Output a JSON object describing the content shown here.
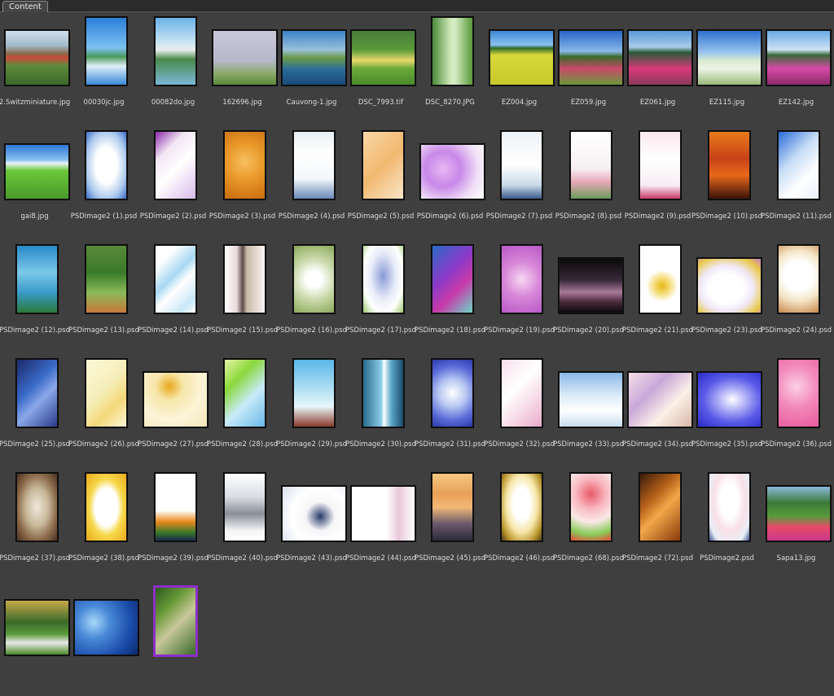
{
  "panel": {
    "tab_label": "Content"
  },
  "items": [
    {
      "name": "2.Switzminiature.jpg",
      "shape": "land",
      "bg": "linear-gradient(#cfe0ef 0%,#9fb8c8 28%,#8a6a4a 42%,#c94a3a 50%,#5f8a3c 64%,#3a6a2a 100%)"
    },
    {
      "name": "00030jc.jpg",
      "shape": "port",
      "bg": "linear-gradient(#2a7fd8 0%,#7ec2f2 45%,#4a9a5a 58%,#dfeef8 72%,#3a8ad8 100%)"
    },
    {
      "name": "00082do.jpg",
      "shape": "port",
      "bg": "linear-gradient(#6ab2e8 0%,#cfe6f2 38%,#e8eef0 48%,#4a8a4a 62%,#7ab8d8 100%)"
    },
    {
      "name": "162696.jpg",
      "shape": "land",
      "bg": "linear-gradient(#c8c8d8 0%,#b8b8cc 55%,#8aa868 80%,#5a8a3a 100%)"
    },
    {
      "name": "Cauvong-1.jpg",
      "shape": "land",
      "bg": "linear-gradient(#3a82c8 0%,#9ac0d8 35%,#6a9a4a 50%,#2a6a9a 72%,#1a4a7a 100%)"
    },
    {
      "name": "DSC_7993.tif",
      "shape": "land",
      "bg": "linear-gradient(#4a7a3a 0%,#5a9a3a 35%,#e8d86a 55%,#6aaa3a 70%,#4a8a2a 100%)"
    },
    {
      "name": "DSC_8270.JPG",
      "shape": "port",
      "bg": "linear-gradient(90deg,#4a8a3a 0%,#cfe8b8 45%,#d8eec8 55%,#5a9a3a 100%)"
    },
    {
      "name": "EZ004.jpg",
      "shape": "land",
      "bg": "linear-gradient(#3f86d8 0%,#8ac2ee 26%,#2f6a2a 32%,#d8d83a 45%,#c8c82a 100%)"
    },
    {
      "name": "EZ059.jpg",
      "shape": "land",
      "bg": "linear-gradient(#2a66c8 0%,#8ab8e8 38%,#3a6a2a 48%,#c84a6a 70%,#6a9a3a 100%)"
    },
    {
      "name": "EZ061.jpg",
      "shape": "land",
      "bg": "linear-gradient(#5a9ad8 0%,#a8cce8 30%,#2a5a3a 40%,#d83a7a 70%,#8a3a5a 100%)"
    },
    {
      "name": "EZ115.jpg",
      "shape": "land",
      "bg": "linear-gradient(#2f6fcf 0%,#9ac6ee 40%,#d8e8d0 55%,#eef4e8 70%,#9aba7a 100%)"
    },
    {
      "name": "EZ142.jpg",
      "shape": "land",
      "bg": "linear-gradient(#6aaae8 0%,#cfe2f2 35%,#3a6a3a 45%,#d84aa8 70%,#8a2a6a 100%)"
    },
    {
      "name": "gai8.jpg",
      "shape": "land",
      "bg": "linear-gradient(#2f78d8 0%,#8ac0ee 28%,#e8f2f8 34%,#6ac83a 48%,#4a9a2a 100%)"
    },
    {
      "name": "PSDimage2 (1).psd",
      "shape": "port",
      "bg": "radial-gradient(ellipse at 50% 50%,#ffffff 38%,#aac8ec 72%,#3a6ac8 100%)"
    },
    {
      "name": "PSDimage2 (2).psd",
      "shape": "port",
      "bg": "linear-gradient(135deg,#8a2aa8 0%,#f2e6f4 28%,#ffffff 55%,#d8b8e8 100%)"
    },
    {
      "name": "PSDimage2 (3).psd",
      "shape": "port",
      "bg": "radial-gradient(circle at 50% 45%,#f8c060 0%,#e89828 45%,#c86a10 100%)"
    },
    {
      "name": "PSDimage2 (4).psd",
      "shape": "port",
      "bg": "linear-gradient(#e8eef4 0%,#ffffff 30%,#f4f8fa 70%,#6a8ab8 100%)"
    },
    {
      "name": "PSDimage2 (5).psd",
      "shape": "port",
      "bg": "linear-gradient(135deg,#f8d8a8 0%,#f2b870 50%,#fae6c8 100%)"
    },
    {
      "name": "PSDimage2 (6).psd",
      "shape": "land",
      "bg": "radial-gradient(circle at 35% 45%,#e8b8f4 0%,#c888e8 35%,#f0e0f6 70%,#ffffff 100%)"
    },
    {
      "name": "PSDimage2 (7).psd",
      "shape": "port",
      "bg": "linear-gradient(#eef2f6 0%,#ffffff 50%,#c8d8e8 80%,#3a5a8a 100%)"
    },
    {
      "name": "PSDimage2 (8).psd",
      "shape": "port",
      "bg": "linear-gradient(#ffffff 0%,#f6f0f2 55%,#e8a8b8 75%,#6a9a5a 100%)"
    },
    {
      "name": "PSDimage2 (9).psd",
      "shape": "port",
      "bg": "linear-gradient(#fbe8f0 0%,#ffffff 40%,#f8eef4 80%,#c83a6a 100%)"
    },
    {
      "name": "PSDimage2 (10).psd",
      "shape": "port",
      "bg": "linear-gradient(#e87a1a 0%,#c8421a 40%,#e8681a 65%,#3a120a 100%)"
    },
    {
      "name": "PSDimage2 (11).psd",
      "shape": "port",
      "bg": "linear-gradient(135deg,#2a6ad8 0%,#c8def6 40%,#ffffff 70%,#e8f0fa 100%)"
    },
    {
      "name": "PSDimage2 (12).psd",
      "shape": "port",
      "bg": "linear-gradient(#2a8ac8 0%,#7ac8e8 40%,#3a9ac8 70%,#2a7a3a 100%)"
    },
    {
      "name": "PSDimage2 (13).psd",
      "shape": "port",
      "bg": "linear-gradient(#5a8a3a 0%,#3a7a2a 40%,#8aba5a 70%,#c8783a 100%)"
    },
    {
      "name": "PSDimage2 (14).psd",
      "shape": "port",
      "bg": "linear-gradient(135deg,#ffffff 20%,#a8d8f2 45%,#ffffff 60%,#c8e8f8 85%,#ffffff 100%)"
    },
    {
      "name": "PSDimage2 (15).psd",
      "shape": "port",
      "bg": "linear-gradient(90deg,#ffffff 0%,#e8d8d8 30%,#5a4a4a 45%,#c8b8a8 55%,#fbf4f2 100%)"
    },
    {
      "name": "PSDimage2 (16).psd",
      "shape": "port",
      "bg": "radial-gradient(circle at 50% 50%,#ffffff 20%,#c8d8a8 55%,#8aa85a 100%)"
    },
    {
      "name": "PSDimage2 (17).psd",
      "shape": "port",
      "bg": "radial-gradient(ellipse at 50% 45%,#8a9ad8 0%,#e8ecf8 45%,#ffffff 70%,#9ac86a 100%)"
    },
    {
      "name": "PSDimage2 (18).psd",
      "shape": "port",
      "bg": "linear-gradient(135deg,#2a6ac8 0%,#8a3ac8 40%,#c83aa8 65%,#6ad8c8 100%)"
    },
    {
      "name": "PSDimage2 (19).psd",
      "shape": "port",
      "bg": "radial-gradient(circle at 50% 50%,#f8d8f4 0%,#d888d8 45%,#b858c8 100%)"
    },
    {
      "name": "PSDimage2 (20).psd",
      "shape": "land",
      "bg": "linear-gradient(#0a0a0a 0%,#3a2a3a 40%,#a87a9a 62%,#4a2a3a 80%,#0a0a0a 100%)"
    },
    {
      "name": "PSDimage2 (21).psd",
      "shape": "port",
      "bg": "radial-gradient(circle at 55% 60%,#e8b81a 0%,#f2d86a 15%,#ffffff 35%,#ffffff 100%)"
    },
    {
      "name": "PSDimage2 (23).psd",
      "shape": "land",
      "bg": "radial-gradient(ellipse at 45% 55%,#ffffff 35%,#f0e8f6 55%,#e8c84a 80%,#c87ac8 100%)"
    },
    {
      "name": "PSDimage2 (24).psd",
      "shape": "port",
      "bg": "radial-gradient(circle at 50% 45%,#ffffff 35%,#f4e6c8 60%,#c8884a 100%)"
    },
    {
      "name": "PSDimage2 (25).psd",
      "shape": "port",
      "bg": "linear-gradient(135deg,#1a2a6a 0%,#3a6ac8 40%,#8aa8e8 60%,#2a3a8a 100%)"
    },
    {
      "name": "PSDimage2 (26).psd",
      "shape": "port",
      "bg": "linear-gradient(135deg,#fbf8d8 0%,#f6eeb8 45%,#f2d87a 70%,#fbf6d8 100%)"
    },
    {
      "name": "PSDimage2 (27).psd",
      "shape": "land",
      "bg": "radial-gradient(circle at 40% 25%,#e8a81a 0%,#f6e6a8 25%,#fbf4d8 60%,#f2e6b8 100%)"
    },
    {
      "name": "PSDimage2 (28).psd",
      "shape": "port",
      "bg": "linear-gradient(135deg,#e8f6a8 0%,#8ad83a 30%,#c8eaf8 60%,#6ab8e8 100%)"
    },
    {
      "name": "PSDimage2 (29).psd",
      "shape": "port",
      "bg": "linear-gradient(#5ab8e8 0%,#a8dcf2 40%,#e8f6fa 70%,#8a3a2a 100%)"
    },
    {
      "name": "PSDimage2 (30).psd",
      "shape": "port",
      "bg": "linear-gradient(90deg,#2a6a8a 0%,#8acce8 45%,#ffffff 52%,#5aa8c8 70%,#1a4a6a 100%)"
    },
    {
      "name": "PSDimage2 (31).psd",
      "shape": "port",
      "bg": "radial-gradient(circle at 50% 50%,#ffffff 0%,#b8c8f2 35%,#5a6ad8 70%,#2a3aa8 100%)"
    },
    {
      "name": "PSDimage2 (32).psd",
      "shape": "port",
      "bg": "linear-gradient(135deg,#f8e0ec 0%,#ffffff 40%,#f4d0e0 75%,#e8a8c8 100%)"
    },
    {
      "name": "PSDimage2 (33).psd",
      "shape": "land",
      "bg": "linear-gradient(#8ab8e8 0%,#d8e8f6 40%,#ffffff 70%,#c8dcee 100%)"
    },
    {
      "name": "PSDimage2 (34).psd",
      "shape": "land",
      "bg": "linear-gradient(135deg,#f6e0e8 0%,#c8a8d8 35%,#fbf0e8 65%,#d8b8a8 100%)"
    },
    {
      "name": "PSDimage2 (35).psd",
      "shape": "land",
      "bg": "radial-gradient(ellipse at 55% 50%,#ffffff 0%,#b8b8f8 25%,#5a5ae8 60%,#2a2ac8 100%)"
    },
    {
      "name": "PSDimage2 (36).psd",
      "shape": "port",
      "bg": "radial-gradient(circle at 45% 40%,#fbd0e4 0%,#f28abc 45%,#e85a9a 100%)"
    },
    {
      "name": "PSDimage2 (37).psd",
      "shape": "port",
      "bg": "radial-gradient(ellipse at 50% 50%,#f0e8dc 0%,#c8b89a 40%,#8a6a4a 70%,#4a3020 100%)"
    },
    {
      "name": "PSDimage2 (38).psd",
      "shape": "port",
      "bg": "radial-gradient(ellipse at 50% 50%,#ffffff 40%,#f6d84a 60%,#e8a81a 100%)"
    },
    {
      "name": "PSDimage2 (39).psd",
      "shape": "port",
      "bg": "linear-gradient(#ffffff 0%,#ffffff 55%,#e8881a 72%,#3a7a2a 88%,#1a2a4a 100%)"
    },
    {
      "name": "PSDimage2 (40).psd",
      "shape": "port",
      "bg": "linear-gradient(#ffffff 0%,#d8dce2 35%,#8a8e98 60%,#f4f4f6 85%,#ffffff 100%)"
    },
    {
      "name": "PSDimage2 (43).psd",
      "shape": "land",
      "bg": "radial-gradient(circle at 60% 55%,#2a3a6a 0%,#f6f6f8 30%,#ffffff 60%,#d8e0ee 100%)"
    },
    {
      "name": "PSDimage2 (44).psd",
      "shape": "land",
      "bg": "linear-gradient(90deg,#ffffff 0%,#ffffff 55%,#e8c8d8 75%,#ffffff 100%)"
    },
    {
      "name": "PSDimage2 (45).psd",
      "shape": "port",
      "bg": "linear-gradient(#f6c880 0%,#e8a058 30%,#f2b878 50%,#6a5a6a 75%,#2a2a3a 100%)"
    },
    {
      "name": "PSDimage2 (46).psd",
      "shape": "port",
      "bg": "radial-gradient(ellipse at 50% 45%,#ffffff 30%,#f6e6a8 55%,#b8942a 80%,#4a3a1a 100%)"
    },
    {
      "name": "PSDimage2 (68).psd",
      "shape": "port",
      "bg": "radial-gradient(circle at 50% 30%,#e85a6a 0%,#f8b8c0 30%,#fbe8e8 55%,#8acc5a 80%,#e8483a 100%)"
    },
    {
      "name": "PSDimage2 (72).psd",
      "shape": "port",
      "bg": "linear-gradient(135deg,#3a1a0a 0%,#b8621a 35%,#f2a84a 55%,#8a3a0a 100%)"
    },
    {
      "name": "PSDimage2.psd",
      "shape": "port",
      "bg": "radial-gradient(ellipse at 50% 40%,#ffffff 30%,#f8e0e6 55%,#e8eef6 80%,#3a4a8a 100%)"
    },
    {
      "name": "Sapa13.jpg",
      "shape": "land",
      "bg": "linear-gradient(#8ab8d8 0%,#3a7a3a 30%,#5a9a3a 55%,#e84a6a 75%,#c83a8a 100%)"
    },
    {
      "name": "",
      "shape": "land",
      "bg": "linear-gradient(#c8a84a 0%,#3a6a2a 40%,#5a9a3a 62%,#e8e8e8 78%,#4a8a2a 100%)"
    },
    {
      "name": "",
      "shape": "land",
      "bg": "radial-gradient(circle at 30% 40%,#a8d8f8 0%,#4a8ad8 30%,#1a4aa8 70%,#0a2a6a 100%)"
    },
    {
      "name": "",
      "shape": "port",
      "selected": true,
      "bg": "linear-gradient(135deg,#2a5a1a 0%,#6a9a3a 30%,#c8c89a 55%,#3a6a2a 100%)"
    }
  ]
}
